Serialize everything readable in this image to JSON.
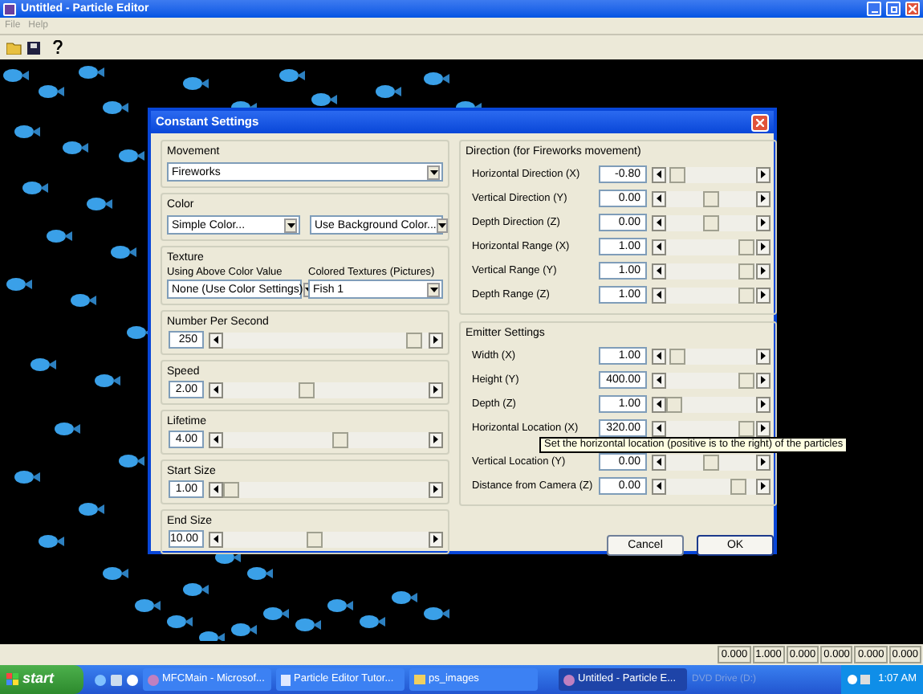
{
  "window": {
    "title": "Untitled - Particle Editor"
  },
  "menu": [
    "File",
    "Help"
  ],
  "dialog": {
    "title": "Constant Settings",
    "movement": {
      "label": "Movement",
      "value": "Fireworks"
    },
    "color": {
      "label": "Color",
      "selects": [
        "Simple Color...",
        "Use Background Color..."
      ]
    },
    "texture": {
      "label": "Texture",
      "columns": [
        {
          "label": "Using Above Color Value",
          "value": "None (Use Color Settings)"
        },
        {
          "label": "Colored Textures (Pictures)",
          "value": "Fish 1"
        }
      ]
    },
    "sliders": [
      {
        "label": "Number Per Second",
        "value": "250",
        "level": 0.97
      },
      {
        "label": "Speed",
        "value": "2.00",
        "level": 0.4
      },
      {
        "label": "Lifetime",
        "value": "4.00",
        "level": 0.58
      },
      {
        "label": "Start Size",
        "value": "1.00",
        "level": 0.0
      },
      {
        "label": "End Size",
        "value": "10.00",
        "level": 0.44
      }
    ],
    "direction": {
      "label": "Direction (for Fireworks movement)",
      "rows": [
        {
          "label": "Horizontal Direction (X)",
          "value": "-0.80",
          "level": 0.05
        },
        {
          "label": "Vertical Direction (Y)",
          "value": "0.00",
          "level": 0.5
        },
        {
          "label": "Depth Direction (Z)",
          "value": "0.00",
          "level": 0.5
        },
        {
          "label": "Horizontal Range (X)",
          "value": "1.00",
          "level": 0.97
        },
        {
          "label": "Vertical Range (Y)",
          "value": "1.00",
          "level": 0.97
        },
        {
          "label": "Depth Range (Z)",
          "value": "1.00",
          "level": 0.97
        }
      ]
    },
    "emitter": {
      "label": "Emitter Settings",
      "rows": [
        {
          "label": "Width (X)",
          "value": "1.00",
          "level": 0.05
        },
        {
          "label": "Height (Y)",
          "value": "400.00",
          "level": 0.97
        },
        {
          "label": "Depth (Z)",
          "value": "1.00",
          "level": 0.0
        },
        {
          "label": "Horizontal Location (X)",
          "value": "320.00",
          "level": 0.97
        },
        {
          "label": "Vertical Location (Y)",
          "value": "0.00",
          "level": 0.5
        },
        {
          "label": "Distance from Camera (Z)",
          "value": "0.00",
          "level": 0.88
        }
      ]
    },
    "tooltip": "Set the horizontal location (positive is to the right) of the particles",
    "buttons": [
      "Cancel",
      "OK"
    ]
  },
  "status_values": [
    "0.000",
    "1.000",
    "0.000",
    "0.000",
    "0.000",
    "0.000"
  ],
  "taskbar": {
    "start": "start",
    "tasks": [
      {
        "label": "MFCMain - Microsof...",
        "selected": false,
        "kind": "app"
      },
      {
        "label": "Particle Editor Tutor...",
        "selected": false,
        "kind": "doc"
      },
      {
        "label": "ps_images",
        "selected": false,
        "kind": "folder"
      },
      {
        "label": "Untitled - Particle E...",
        "selected": true,
        "kind": "app"
      }
    ],
    "drive": "DVD Drive (D:)",
    "clock": "1:07 AM"
  }
}
